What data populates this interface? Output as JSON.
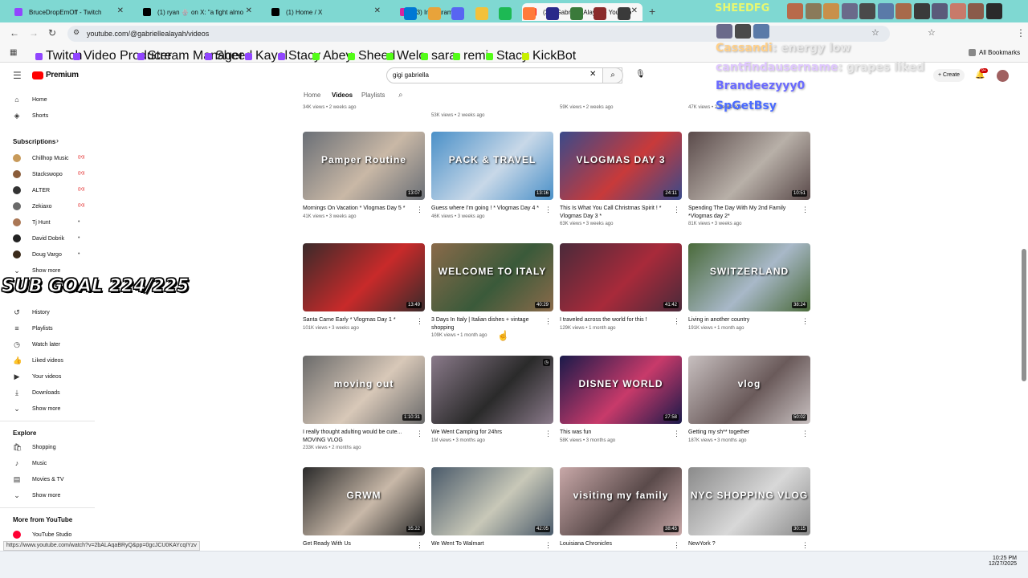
{
  "browser": {
    "tabs": [
      {
        "label": "BruceDropEmOff - Twitch",
        "color": "#9146ff"
      },
      {
        "label": "(1) ryan 🪬 on X: \"a fight almo",
        "color": "#000000"
      },
      {
        "label": "(1) Home / X",
        "color": "#000000"
      },
      {
        "label": "(3) Instagram",
        "color": "#d6249f"
      },
      {
        "label": "(35) Gabrielle Alayah - YouTube",
        "color": "#ff0000"
      }
    ],
    "url": "youtube.com/@gabriellealayah/videos",
    "bookmarks": [
      "Twitch",
      "Video Producer",
      "Stream Manager",
      "Sheed",
      "Kayel",
      "Stacy",
      "Abey",
      "Sheed",
      "Welo",
      "sara",
      "remi",
      "Stacy",
      "KickBot"
    ],
    "all_bookmarks": "All Bookmarks",
    "status_url": "https://www.youtube.com/watch?v=2bALAqaBRyQ&pp=0gcJCU0KAYcqIYzv"
  },
  "overlay": {
    "streamer_name": "SHEEDFG",
    "chat": [
      {
        "user": "Cassandi",
        "text": ": energy low",
        "color": "#ffd08a"
      },
      {
        "user": "cantfindausername",
        "text": ": grapes liked",
        "color": "#e0c8ff"
      },
      {
        "user": "Brandeezyyy0",
        "text": "",
        "color": "#6b6bff"
      },
      {
        "user": "SpGetBsy",
        "text": "",
        "color": "#4a6bff"
      }
    ],
    "sub_goal": "SUB GOAL 224/225"
  },
  "youtube": {
    "logo": "Premium",
    "search_value": "gigi gabriella",
    "create_label": "Create",
    "notif_count": "9+",
    "sidebar": {
      "main": [
        {
          "label": "Home",
          "icon": "home-icon"
        },
        {
          "label": "Shorts",
          "icon": "shorts-icon"
        }
      ],
      "subscriptions_heading": "Subscriptions",
      "subscriptions": [
        {
          "label": "Chillhop Music",
          "color": "#c89a5a",
          "live": true
        },
        {
          "label": "Stackswopo",
          "color": "#8a5c3a",
          "live": true
        },
        {
          "label": "ALTER",
          "color": "#333333",
          "live": true
        },
        {
          "label": "Zekiaxo",
          "color": "#6a6a6a",
          "live": true
        },
        {
          "label": "Tj Hunt",
          "color": "#aa7755",
          "live": false
        },
        {
          "label": "David Dobrik",
          "color": "#222222",
          "live": false
        },
        {
          "label": "Doug Vargo",
          "color": "#3a2a1a",
          "live": false
        }
      ],
      "show_more": "Show more",
      "you": [
        {
          "label": "History",
          "icon": "history-icon"
        },
        {
          "label": "Playlists",
          "icon": "playlists-icon"
        },
        {
          "label": "Watch later",
          "icon": "watch-later-icon"
        },
        {
          "label": "Liked videos",
          "icon": "liked-icon"
        },
        {
          "label": "Your videos",
          "icon": "your-videos-icon"
        },
        {
          "label": "Downloads",
          "icon": "downloads-icon"
        }
      ],
      "explore_heading": "Explore",
      "explore": [
        {
          "label": "Shopping",
          "icon": "shopping-icon"
        },
        {
          "label": "Music",
          "icon": "music-icon"
        },
        {
          "label": "Movies & TV",
          "icon": "movies-icon"
        }
      ],
      "more_heading": "More from YouTube",
      "studio": "YouTube Studio"
    },
    "channel_tabs": [
      "Home",
      "Videos",
      "Playlists"
    ],
    "top_partial_meta": [
      "34K views • 2 weeks ago",
      "53K views • 2 weeks ago",
      "59K views • 2 weeks ago",
      "47K views • 2 weeks ago"
    ],
    "videos": [
      {
        "title": "Mornings On Vacation * Vlogmas Day 5 *",
        "meta": "41K views • 3 weeks ago",
        "duration": "13:07",
        "c1": "#6a6f76",
        "c2": "#c9b8a6",
        "overlay": "Pamper Routine"
      },
      {
        "title": "Guess where I'm going ! * Vlogmas Day 4 *",
        "meta": "46K views • 3 weeks ago",
        "duration": "13:16",
        "c1": "#4a90c8",
        "c2": "#c8d8e8",
        "overlay": "PACK & TRAVEL"
      },
      {
        "title": "This Is What You Call Christmas Spirit ! * Vlogmas Day 3 *",
        "meta": "63K views • 3 weeks ago",
        "duration": "24:11",
        "c1": "#3a4a8a",
        "c2": "#c83a3a",
        "overlay": "VLOGMAS DAY 3"
      },
      {
        "title": "Spending The Day With My 2nd Family *Vlogmas day 2*",
        "meta": "81K views • 3 weeks ago",
        "duration": "10:51",
        "c1": "#5a4a4a",
        "c2": "#b8b0a8",
        "overlay": ""
      },
      {
        "title": "Santa Came Early * Vlogmas Day 1 *",
        "meta": "101K views • 3 weeks ago",
        "duration": "13:49",
        "c1": "#3a2a2a",
        "c2": "#c82a2a",
        "overlay": ""
      },
      {
        "title": "3 Days In Italy | Italian dishes + vintage shopping",
        "meta": "109K views • 1 month ago",
        "duration": "40:29",
        "c1": "#8a6a4a",
        "c2": "#3a5a3a",
        "overlay": "WELCOME TO ITALY"
      },
      {
        "title": "I traveled across the world for this !",
        "meta": "129K views • 1 month ago",
        "duration": "41:42",
        "c1": "#4a2a3a",
        "c2": "#a82a3a",
        "overlay": ""
      },
      {
        "title": "Living in another country",
        "meta": "191K views • 1 month ago",
        "duration": "38:24",
        "c1": "#4a6a3a",
        "c2": "#a8b8c8",
        "overlay": "SWITZERLAND"
      },
      {
        "title": "I really thought adulting would be cute... MOVING VLOG",
        "meta": "233K views • 2 months ago",
        "duration": "1:10:31",
        "c1": "#6a6a6a",
        "c2": "#d8c8b8",
        "overlay": "moving out"
      },
      {
        "title": "We Went Camping for 24hrs",
        "meta": "1M views • 3 months ago",
        "duration": "",
        "c1": "#8a7a8a",
        "c2": "#2a2a2a",
        "overlay": ""
      },
      {
        "title": "This was fun",
        "meta": "58K views • 3 months ago",
        "duration": "27:58",
        "c1": "#1a1a4a",
        "c2": "#c83a6a",
        "overlay": "DISNEY WORLD"
      },
      {
        "title": "Getting my sh** together",
        "meta": "187K views • 3 months ago",
        "duration": "50:02",
        "c1": "#c8c0c0",
        "c2": "#6a5a5a",
        "overlay": "vlog"
      },
      {
        "title": "Get Ready With Us",
        "meta": "",
        "duration": "35:22",
        "c1": "#2a2a2a",
        "c2": "#c8b8a8",
        "overlay": "GRWM"
      },
      {
        "title": "We Went To Walmart",
        "meta": "",
        "duration": "42:05",
        "c1": "#4a5a6a",
        "c2": "#c8c8b8",
        "overlay": ""
      },
      {
        "title": "Louisiana Chronicles",
        "meta": "",
        "duration": "38:45",
        "c1": "#c8a8a8",
        "c2": "#5a4a4a",
        "overlay": "visiting my family"
      },
      {
        "title": "NewYork ?",
        "meta": "",
        "duration": "30:15",
        "c1": "#8a8a8a",
        "c2": "#d8d8d8",
        "overlay": "NYC SHOPPING VLOG"
      }
    ]
  },
  "taskbar": {
    "time": "10:25 PM",
    "date": "12/27/2025"
  }
}
